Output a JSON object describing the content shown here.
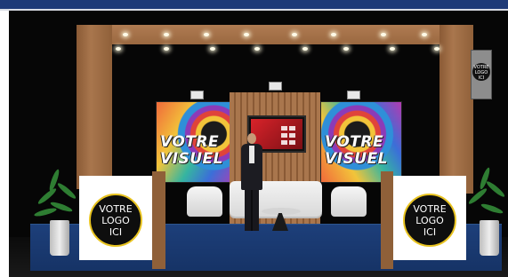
{
  "booth": {
    "panel_left_text": {
      "line1": "VOTRE",
      "line2": "VISUEL"
    },
    "panel_right_text": {
      "line1": "VOTRE",
      "line2": "VISUEL"
    },
    "counter_left_logo": {
      "line1": "VOTRE",
      "line2": "LOGO",
      "line3": "ICI"
    },
    "counter_right_logo": {
      "line1": "VOTRE",
      "line2": "LOGO",
      "line3": "ICI"
    },
    "hanging_sign_logo": {
      "line1": "VOTRE",
      "line2": "LOGO",
      "line3": "ICI"
    }
  },
  "colors": {
    "header_bar": "#1e3a78",
    "carpet": "#1d3f7a",
    "wood": "#a9764d",
    "logo_ring": "#e8c320"
  }
}
